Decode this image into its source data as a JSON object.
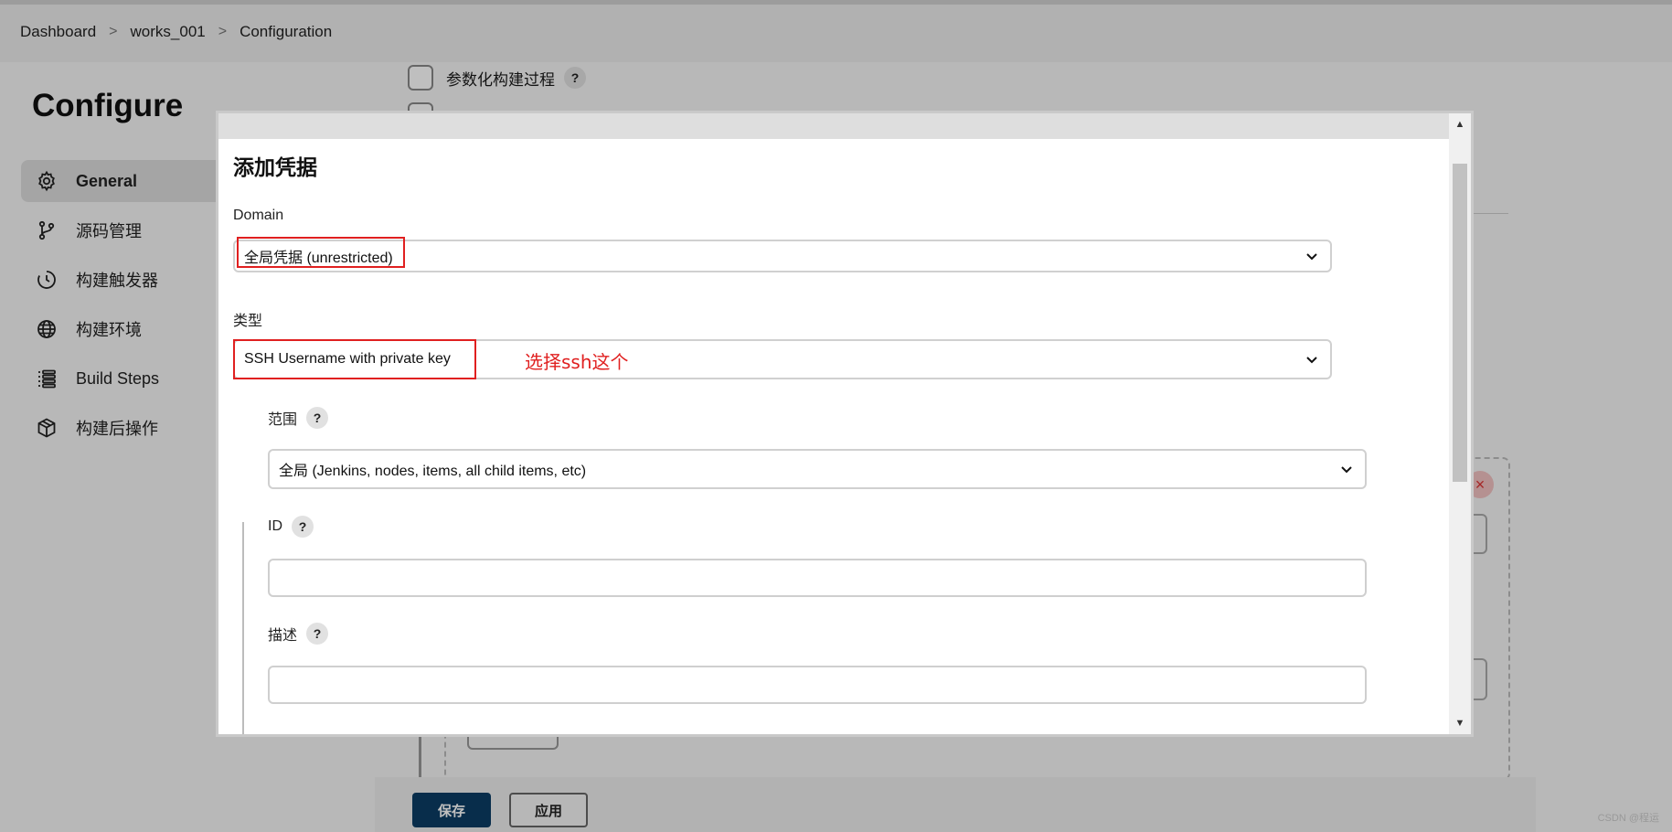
{
  "breadcrumb": {
    "items": [
      "Dashboard",
      "works_001",
      "Configuration"
    ],
    "separator": ">"
  },
  "page": {
    "title": "Configure"
  },
  "sidebar": {
    "items": [
      {
        "label": "General",
        "icon": "gear-icon",
        "active": true
      },
      {
        "label": "源码管理",
        "icon": "git-branch-icon"
      },
      {
        "label": "构建触发器",
        "icon": "timer-icon"
      },
      {
        "label": "构建环境",
        "icon": "globe-icon"
      },
      {
        "label": "Build Steps",
        "icon": "list-icon"
      },
      {
        "label": "构建后操作",
        "icon": "package-icon"
      }
    ]
  },
  "background": {
    "param_checkbox_label": "参数化构建过程",
    "help": "?",
    "remove_icon": "×"
  },
  "dialog": {
    "title": "添加凭据",
    "domain": {
      "label": "Domain",
      "value": "全局凭据 (unrestricted)"
    },
    "type": {
      "label": "类型",
      "value": "SSH Username with private key",
      "annotation": "选择ssh这个"
    },
    "scope": {
      "label": "范围",
      "value": "全局 (Jenkins, nodes, items, all child items, etc)",
      "help": "?"
    },
    "id": {
      "label": "ID",
      "value": "",
      "help": "?"
    },
    "description": {
      "label": "描述",
      "value": "",
      "help": "?"
    },
    "scroll_up": "▲",
    "scroll_down": "▼"
  },
  "footer": {
    "save": "保存",
    "apply": "应用"
  },
  "watermark": "CSDN @程运",
  "colors": {
    "save_button": "#0b3d64",
    "highlight": "#e02020"
  }
}
